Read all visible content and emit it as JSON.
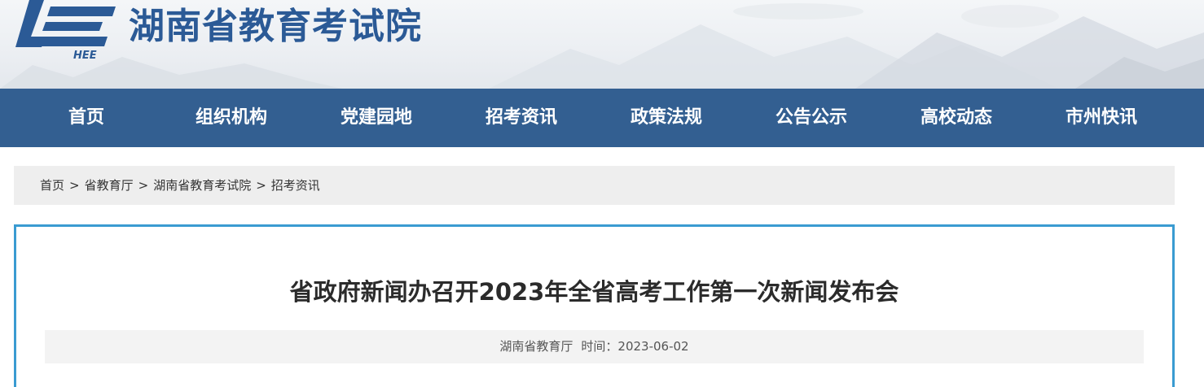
{
  "header": {
    "site_title": "湖南省教育考试院",
    "logo_text": "HEE",
    "colors": {
      "title": "#2b5a96",
      "logo": "#2b5a96"
    }
  },
  "nav": {
    "items": [
      {
        "label": "首页"
      },
      {
        "label": "组织机构"
      },
      {
        "label": "党建园地"
      },
      {
        "label": "招考资讯"
      },
      {
        "label": "政策法规"
      },
      {
        "label": "公告公示"
      },
      {
        "label": "高校动态"
      },
      {
        "label": "市州快讯"
      }
    ],
    "colors": {
      "background": "#335f91",
      "text": "#ffffff"
    }
  },
  "breadcrumb": {
    "items": [
      "首页",
      "省教育厅",
      "湖南省教育考试院",
      "招考资讯"
    ],
    "separator": ">"
  },
  "article": {
    "title": "省政府新闻办召开2023年全省高考工作第一次新闻发布会",
    "source": "湖南省教育厅",
    "time_label": "时间：",
    "date": "2023-06-02",
    "colors": {
      "border": "#3a9bd1"
    }
  }
}
